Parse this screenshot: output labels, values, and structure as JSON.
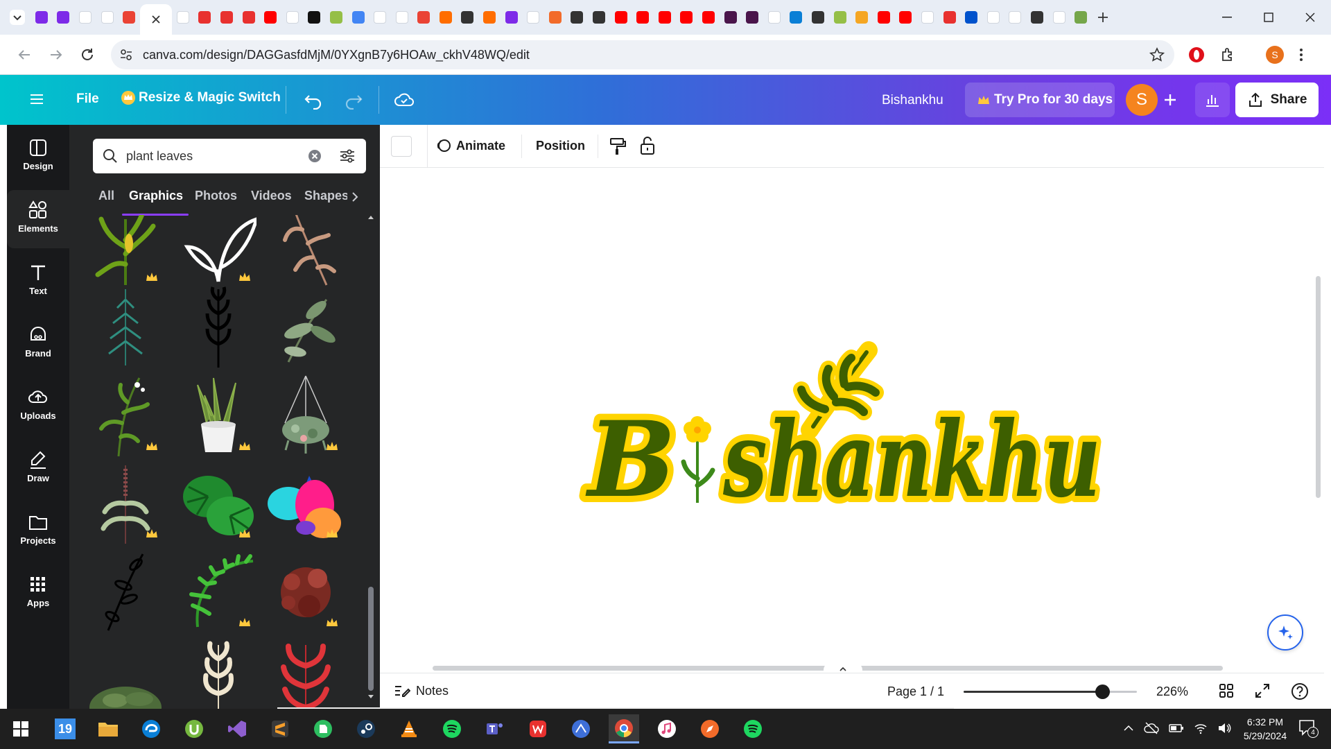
{
  "browser": {
    "url": "canva.com/design/DAGGasfdMjM/0YXgnB7y6HOAw_ckhV48WQ/edit",
    "profile_initial": "S",
    "tab_favicons": [
      "canva",
      "canva",
      "google",
      "google",
      "gmail",
      "close",
      "google",
      "pdf",
      "pdf",
      "pdf",
      "youtube",
      "google",
      "dash",
      "shopify",
      "g-blue",
      "google",
      "google",
      "gmail",
      "fire",
      "chatgpt",
      "d-letter",
      "canva",
      "google",
      "orange",
      "chatgpt",
      "chatgpt",
      "youtube",
      "youtube",
      "youtube",
      "youtube",
      "youtube",
      "slack",
      "slack",
      "google",
      "edge",
      "chatgpt",
      "shopify",
      "medium",
      "youtube",
      "youtube",
      "google",
      "gpt-c",
      "jira",
      "google",
      "google",
      "chatgpt",
      "google",
      "gpt"
    ]
  },
  "header": {
    "file_label": "File",
    "resize_label": "Resize & Magic Switch",
    "design_title": "Bishankhu",
    "try_pro_label": "Try Pro for 30 days",
    "avatar_initial": "S",
    "share_label": "Share"
  },
  "rail": {
    "items": [
      {
        "label": "Design",
        "icon": "design-icon"
      },
      {
        "label": "Elements",
        "icon": "elements-icon"
      },
      {
        "label": "Text",
        "icon": "text-icon"
      },
      {
        "label": "Brand",
        "icon": "brand-icon"
      },
      {
        "label": "Uploads",
        "icon": "uploads-icon"
      },
      {
        "label": "Draw",
        "icon": "draw-icon"
      },
      {
        "label": "Projects",
        "icon": "projects-icon"
      },
      {
        "label": "Apps",
        "icon": "apps-icon"
      }
    ]
  },
  "panel": {
    "search_value": "plant leaves",
    "categories": [
      "All",
      "Graphics",
      "Photos",
      "Videos",
      "Shapes"
    ],
    "active_category": "Graphics"
  },
  "toolbar": {
    "animate_label": "Animate",
    "position_label": "Position"
  },
  "design": {
    "logo_text_first": "B",
    "logo_text_rest": "shankhu"
  },
  "footer": {
    "notes_label": "Notes",
    "page_label": "Page 1 / 1",
    "zoom_label": "226%",
    "zoom_fraction": 0.8
  },
  "taskbar": {
    "clock_time": "6:32 PM",
    "clock_date": "5/29/2024",
    "notification_count": "4",
    "calendar_day": "19"
  },
  "colors": {
    "logo_green": "#3d5f00",
    "logo_yellow": "#ffd400",
    "canva_teal": "#00c4cc",
    "canva_purple": "#7b2ff7",
    "panel_bg": "#252627"
  }
}
